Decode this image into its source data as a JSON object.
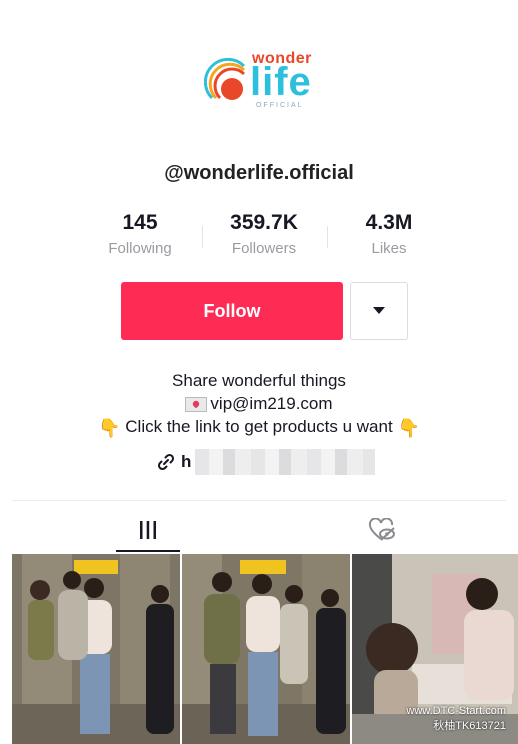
{
  "profile": {
    "logo": {
      "top": "wonder",
      "main": "life",
      "sub": "OFFICIAL"
    },
    "handle": "@wonderlife.official"
  },
  "stats": [
    {
      "value": "145",
      "label": "Following"
    },
    {
      "value": "359.7K",
      "label": "Followers"
    },
    {
      "value": "4.3M",
      "label": "Likes"
    }
  ],
  "actions": {
    "follow_label": "Follow"
  },
  "bio": {
    "line1": "Share wonderful things",
    "line2": "vip@im219.com",
    "line3": "Click the link to get products u want",
    "link_text": "h"
  },
  "icons": {
    "grid": "grid-icon",
    "liked": "heart-eye-icon",
    "dropdown": "caret-down-icon",
    "link": "link-icon"
  },
  "colors": {
    "follow": "#fe2c55",
    "text": "#161823",
    "muted": "#9a9ba1"
  },
  "watermark": {
    "line1": "www.DTC-Start.com",
    "line2": "秋柚TK613721"
  }
}
